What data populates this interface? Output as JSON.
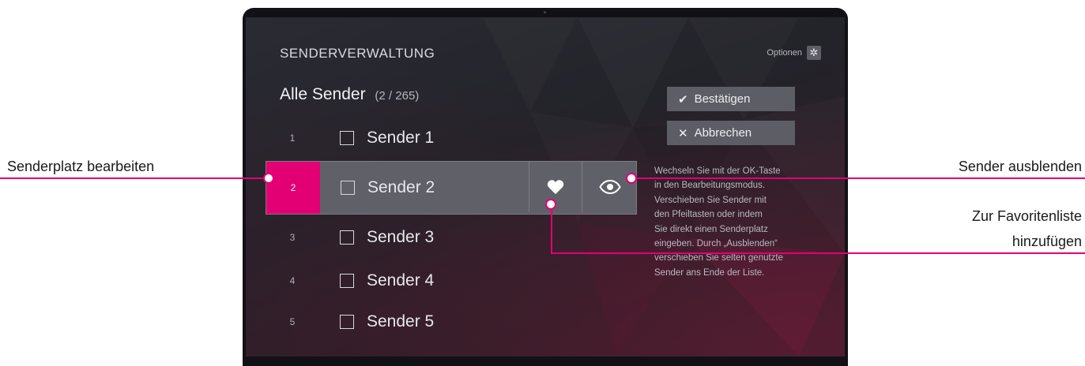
{
  "screen": {
    "title": "SENDERVERWALTUNG",
    "options_label": "Optionen",
    "options_icon": "gear-icon",
    "list_title": "Alle Sender",
    "list_count": "(2 / 265)",
    "channels": [
      {
        "number": "1",
        "name": "Sender 1"
      },
      {
        "number": "2",
        "name": "Sender 2"
      },
      {
        "number": "3",
        "name": "Sender 3"
      },
      {
        "number": "4",
        "name": "Sender 4"
      },
      {
        "number": "5",
        "name": "Sender 5"
      }
    ],
    "selected_index": 1,
    "confirm_label": "Bestätigen",
    "cancel_label": "Abbrechen",
    "help_lines": [
      "Wechseln Sie mit der OK-Taste",
      "in den Bearbeitungsmodus.",
      "Verschieben Sie Sender mit",
      "den Pfeiltasten oder indem",
      "Sie direkt einen Senderplatz",
      "eingeben. Durch „Ausblenden“",
      "verschieben Sie selten genutzte",
      "Sender ans Ende der Liste."
    ]
  },
  "annotations": {
    "edit_slot": "Senderplatz bearbeiten",
    "hide_channel": "Sender ausblenden",
    "favorites_line1": "Zur Favoritenliste",
    "favorites_line2": "hinzufügen"
  },
  "colors": {
    "accent": "#e20074",
    "panel": "#5f6068",
    "background": "#23232a"
  }
}
